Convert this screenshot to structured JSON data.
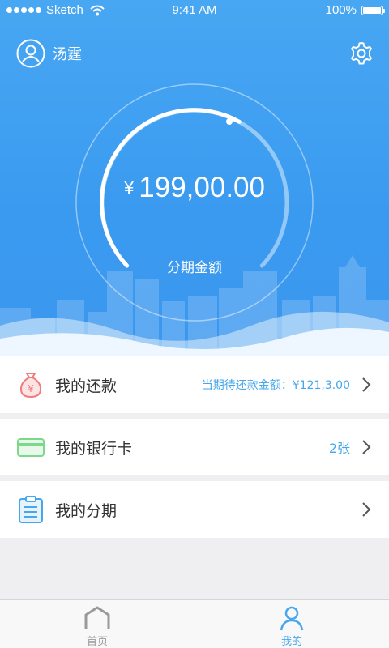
{
  "status_bar": {
    "carrier": "Sketch",
    "time": "9:41 AM",
    "battery": "100%"
  },
  "profile": {
    "name": "汤霆"
  },
  "gauge": {
    "currency": "¥",
    "amount": "199,00.00",
    "label": "分期金额"
  },
  "menu": {
    "repayment": {
      "label": "我的还款",
      "info": "当期待还款金额：¥121,3.00"
    },
    "bank_cards": {
      "label": "我的银行卡",
      "info": "2张"
    },
    "installments": {
      "label": "我的分期"
    }
  },
  "tabbar": {
    "home": "首页",
    "mine": "我的"
  },
  "colors": {
    "accent": "#46a7ec",
    "hero_top": "#48a7f2",
    "bank_card_icon": "#7dd98a",
    "money_bag_icon": "#f07c7c"
  }
}
